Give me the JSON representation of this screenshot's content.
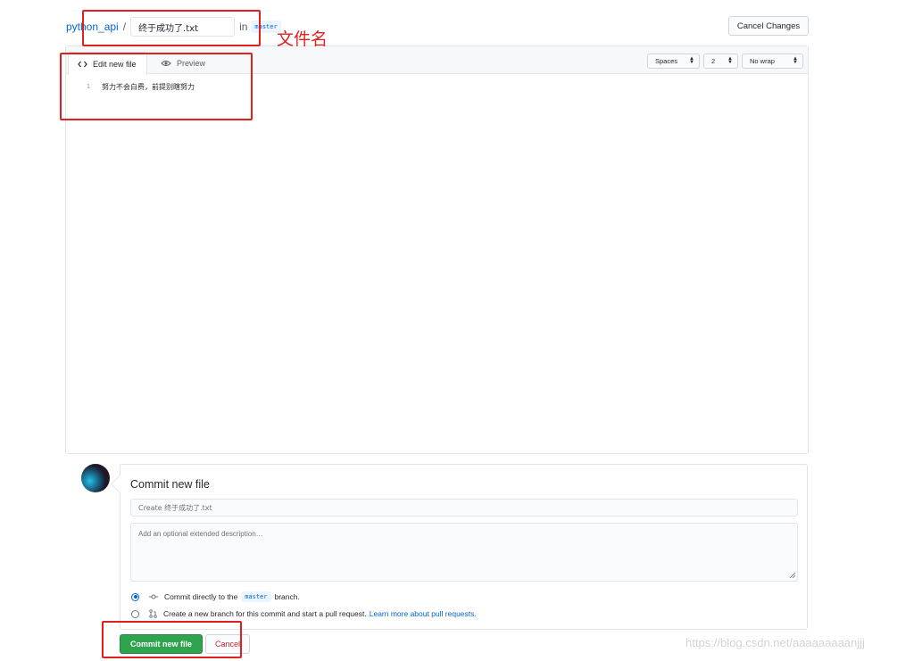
{
  "breadcrumb": {
    "repo": "python_api",
    "separator": "/",
    "filename_value": "终于成功了.txt",
    "in_label": "in",
    "branch": "master"
  },
  "header": {
    "cancel_changes_label": "Cancel Changes"
  },
  "editor": {
    "tabs": [
      {
        "label": "Edit new file",
        "icon": "code-icon",
        "active": true
      },
      {
        "label": "Preview",
        "icon": "eye-icon",
        "active": false
      }
    ],
    "indent_mode": "Spaces",
    "indent_size": "2",
    "wrap_mode": "No wrap",
    "lines": [
      {
        "number": "1",
        "text": "努力不会白费，前提别瞎努力"
      }
    ]
  },
  "commit": {
    "title": "Commit new file",
    "summary_placeholder": "Create 终于成功了.txt",
    "description_placeholder": "Add an optional extended description…",
    "option_direct": {
      "prefix": "Commit directly to the",
      "branch": "master",
      "suffix": "branch."
    },
    "option_new_branch": {
      "text": "Create a new branch for this commit and start a pull request.",
      "link": "Learn more about pull requests."
    },
    "commit_button_label": "Commit new file",
    "cancel_button_label": "Cancel"
  },
  "annotations": {
    "filename_label": "文件名",
    "color": "#e0201e"
  },
  "watermark": "https://blog.csdn.net/aaaaaaaaanjjj",
  "colors": {
    "link": "#0366d6",
    "commit_green": "#2ea44f",
    "cancel_red": "#cb2431"
  }
}
